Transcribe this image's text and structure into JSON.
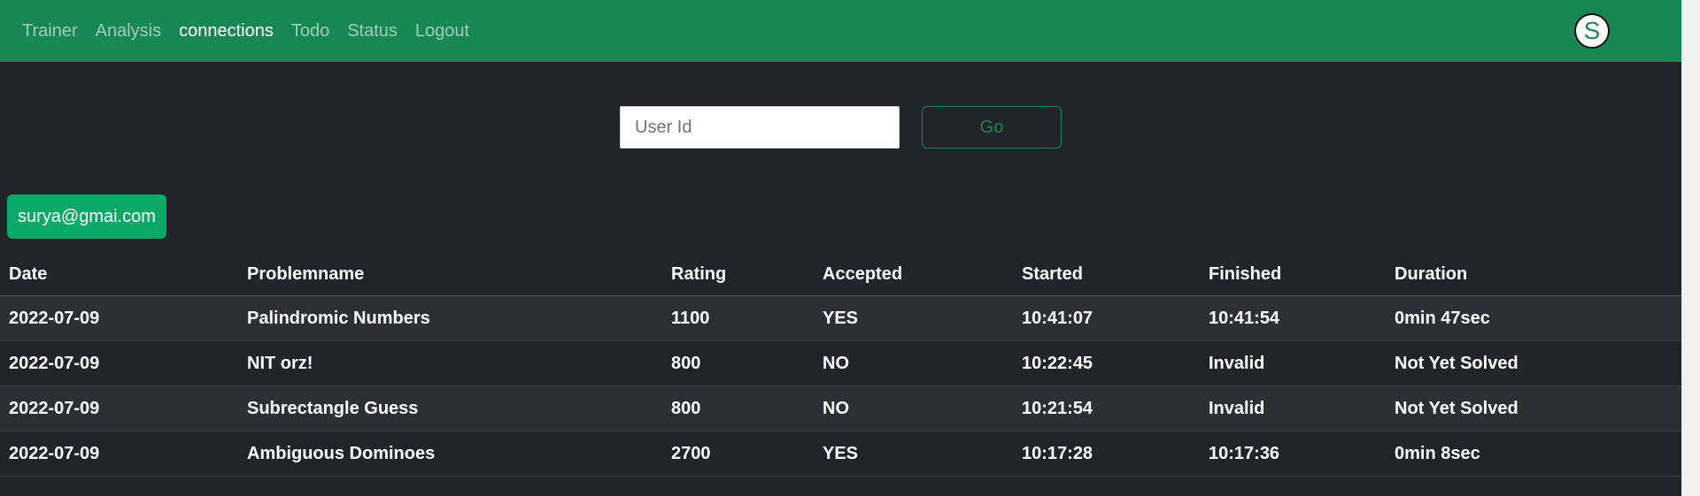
{
  "nav": {
    "links": [
      {
        "label": "Trainer",
        "active": false
      },
      {
        "label": "Analysis",
        "active": false
      },
      {
        "label": "connections",
        "active": true
      },
      {
        "label": "Todo",
        "active": false
      },
      {
        "label": "Status",
        "active": false
      },
      {
        "label": "Logout",
        "active": false
      }
    ],
    "avatar_letter": "S"
  },
  "search": {
    "placeholder": "User Id",
    "value": "",
    "button_label": "Go"
  },
  "user_badge": "surya@gmai.com",
  "table": {
    "columns": [
      "Date",
      "Problemname",
      "Rating",
      "Accepted",
      "Started",
      "Finished",
      "Duration"
    ],
    "rows": [
      [
        "2022-07-09",
        "Palindromic Numbers",
        "1100",
        "YES",
        "10:41:07",
        "10:41:54",
        "0min 47sec"
      ],
      [
        "2022-07-09",
        "NIT orz!",
        "800",
        "NO",
        "10:22:45",
        "Invalid",
        "Not Yet Solved"
      ],
      [
        "2022-07-09",
        "Subrectangle Guess",
        "800",
        "NO",
        "10:21:54",
        "Invalid",
        "Not Yet Solved"
      ],
      [
        "2022-07-09",
        "Ambiguous Dominoes",
        "2700",
        "YES",
        "10:17:28",
        "10:17:36",
        "0min 8sec"
      ]
    ]
  },
  "colors": {
    "navbar": "#198754",
    "page_background": "#212529",
    "badge": "#0ca868",
    "go_button": "#198754"
  }
}
